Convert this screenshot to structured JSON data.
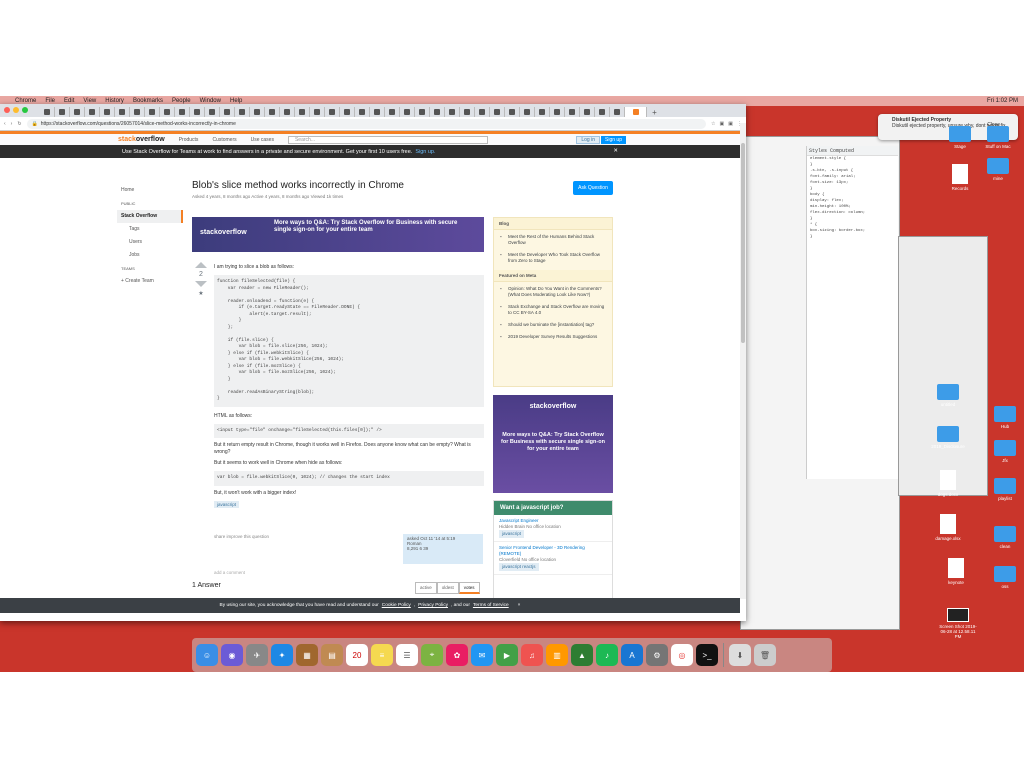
{
  "menubar": {
    "items": [
      "Chrome",
      "File",
      "Edit",
      "View",
      "History",
      "Bookmarks",
      "People",
      "Window",
      "Help"
    ],
    "clock": "Fri 1:02 PM"
  },
  "notification": {
    "title": "Diskutil Ejected Property",
    "body": "Diskutil ejected property, unsure why, dont worry fix.",
    "close_label": "Close"
  },
  "browser": {
    "url": "https://stackoverflow.com/questions/26057014/slice-method-works-incorrectly-in-chrome"
  },
  "so": {
    "logo_prefix": "stack",
    "logo_suffix": "overflow",
    "nav": [
      "Products",
      "Customers",
      "Use cases"
    ],
    "search_placeholder": "Search...",
    "login_label": "Log in",
    "signup_label": "Sign up",
    "teams_banner_text": "Use Stack Overflow for Teams at work to find answers in a private and secure environment. Get your first 10 users free.",
    "teams_banner_link": "Sign up.",
    "left_nav": [
      "Home",
      "PUBLIC",
      "Stack Overflow",
      "Tags",
      "Users",
      "Jobs",
      "TEAMS",
      "+ Create Team"
    ],
    "question": {
      "title": "Blob's slice method works incorrectly in Chrome",
      "meta": "Asked 4 years, 8 months ago   Active 4 years, 8 months ago   Viewed 1k times",
      "votes": "2",
      "intro": "I am trying to slice a blob as follows:",
      "code1": "function fileSelected(file) {\n    var reader = new FileReader();\n\n    reader.onloadend = function(e) {\n        if (e.target.readyState == FileReader.DONE) {\n            alert(e.target.result);\n        }\n    };\n\n    if (file.slice) {\n        var blob = file.slice(256, 1024);\n    } else if (file.webkitSlice) {\n        var blob = file.webkitSlice(256, 1024);\n    } else if (file.mozSlice) {\n        var blob = file.mozSlice(256, 1024);\n    }\n\n    reader.readAsBinaryString(blob);\n}",
      "html_intro": "HTML as follows:",
      "code2": "<input type=\"file\" onchange=\"fileSelected(this.files[0]);\" />",
      "para2": "But it return empty result in Chrome, though it works well in Firefox. Does anyone know what can be empty? What is wrong?",
      "para3": "But it seems to work well in Chrome when hide as follows:",
      "code3": "var blob = file.webkitSlice(0, 1024); // changes the start index",
      "para4": "But, it won't work with a bigger index!",
      "tag": "javascript",
      "footer": "share  improve this question",
      "asker_card": "asked Oct 11 '14 at 5:19\nRoman\n8,291  6  39",
      "add_comment": "add a comment",
      "answers_count": "1 Answer",
      "sort_tabs": [
        "active",
        "oldest",
        "votes"
      ]
    },
    "ask_button": "Ask Question",
    "ad_banner": {
      "logo": "stackoverflow",
      "text": "More ways to Q&A: Try Stack Overflow for Business with secure single sign-on for your entire team"
    },
    "blog": {
      "heading": "Blog",
      "items": [
        "Meet the Rest of the Humans Behind Stack Overflow",
        "Meet the Developer Who Took Stack Overflow from Zero to Stage"
      ],
      "meta_heading": "Featured on Meta",
      "meta_items": [
        "Opinion: What Do You Want in the Comments? (What Does Moderating Look Like Now?)",
        "Stack Exchange and Stack Overflow are moving to CC BY-SA 4.0",
        "Should we burninate the [instantiation] tag?",
        "2019 Developer Survey Results Suggestions"
      ]
    },
    "side_ad": {
      "logo": "stackoverflow",
      "text": "More ways to Q&A: Try Stack Overflow for Business with secure single sign-on for your entire team"
    },
    "jobs": {
      "heading": "Want a javascript job?",
      "items": [
        {
          "title": "Javascript Engineer",
          "company": "Hidden Brain   No office location",
          "tags": "javascript"
        },
        {
          "title": "Senior Frontend Developer - 3D Rendering (REMOTE)",
          "company": "Cloverfield   No office location",
          "tags": "javascript  reactjs"
        }
      ]
    },
    "cookie": {
      "text": "By using our site, you acknowledge that you have read and understand our",
      "link1": "Cookie Policy",
      "link2": "Privacy Policy",
      "and": ", and our",
      "link3": "Terms of Service",
      "close": "×"
    }
  },
  "desktop_icons": [
    "Stage",
    "Stuff on Mac",
    "Records",
    "mine",
    "untitled",
    "Hub",
    "Tabu",
    "2019_Disclosure",
    "Jfx",
    "doc",
    "Mood",
    "dogs.docx",
    "playlist",
    "damage.xlsx",
    "clean",
    "keynote",
    "Screen Shot 2019-06-28 at 12.58.11 PM",
    "oss"
  ],
  "colors": {
    "desktop": "#c9352b",
    "so_orange": "#f48024",
    "so_blue": "#0095ff"
  }
}
